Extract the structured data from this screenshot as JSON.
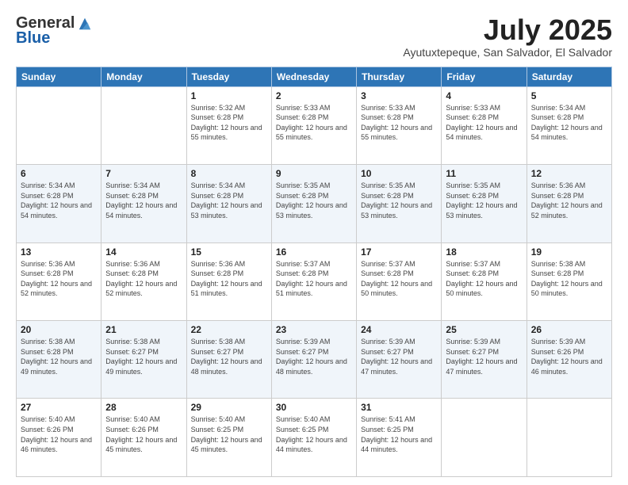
{
  "logo": {
    "general": "General",
    "blue": "Blue"
  },
  "header": {
    "month": "July 2025",
    "location": "Ayutuxtepeque, San Salvador, El Salvador"
  },
  "days_of_week": [
    "Sunday",
    "Monday",
    "Tuesday",
    "Wednesday",
    "Thursday",
    "Friday",
    "Saturday"
  ],
  "weeks": [
    [
      {
        "day": "",
        "info": ""
      },
      {
        "day": "",
        "info": ""
      },
      {
        "day": "1",
        "info": "Sunrise: 5:32 AM\nSunset: 6:28 PM\nDaylight: 12 hours and 55 minutes."
      },
      {
        "day": "2",
        "info": "Sunrise: 5:33 AM\nSunset: 6:28 PM\nDaylight: 12 hours and 55 minutes."
      },
      {
        "day": "3",
        "info": "Sunrise: 5:33 AM\nSunset: 6:28 PM\nDaylight: 12 hours and 55 minutes."
      },
      {
        "day": "4",
        "info": "Sunrise: 5:33 AM\nSunset: 6:28 PM\nDaylight: 12 hours and 54 minutes."
      },
      {
        "day": "5",
        "info": "Sunrise: 5:34 AM\nSunset: 6:28 PM\nDaylight: 12 hours and 54 minutes."
      }
    ],
    [
      {
        "day": "6",
        "info": "Sunrise: 5:34 AM\nSunset: 6:28 PM\nDaylight: 12 hours and 54 minutes."
      },
      {
        "day": "7",
        "info": "Sunrise: 5:34 AM\nSunset: 6:28 PM\nDaylight: 12 hours and 54 minutes."
      },
      {
        "day": "8",
        "info": "Sunrise: 5:34 AM\nSunset: 6:28 PM\nDaylight: 12 hours and 53 minutes."
      },
      {
        "day": "9",
        "info": "Sunrise: 5:35 AM\nSunset: 6:28 PM\nDaylight: 12 hours and 53 minutes."
      },
      {
        "day": "10",
        "info": "Sunrise: 5:35 AM\nSunset: 6:28 PM\nDaylight: 12 hours and 53 minutes."
      },
      {
        "day": "11",
        "info": "Sunrise: 5:35 AM\nSunset: 6:28 PM\nDaylight: 12 hours and 53 minutes."
      },
      {
        "day": "12",
        "info": "Sunrise: 5:36 AM\nSunset: 6:28 PM\nDaylight: 12 hours and 52 minutes."
      }
    ],
    [
      {
        "day": "13",
        "info": "Sunrise: 5:36 AM\nSunset: 6:28 PM\nDaylight: 12 hours and 52 minutes."
      },
      {
        "day": "14",
        "info": "Sunrise: 5:36 AM\nSunset: 6:28 PM\nDaylight: 12 hours and 52 minutes."
      },
      {
        "day": "15",
        "info": "Sunrise: 5:36 AM\nSunset: 6:28 PM\nDaylight: 12 hours and 51 minutes."
      },
      {
        "day": "16",
        "info": "Sunrise: 5:37 AM\nSunset: 6:28 PM\nDaylight: 12 hours and 51 minutes."
      },
      {
        "day": "17",
        "info": "Sunrise: 5:37 AM\nSunset: 6:28 PM\nDaylight: 12 hours and 50 minutes."
      },
      {
        "day": "18",
        "info": "Sunrise: 5:37 AM\nSunset: 6:28 PM\nDaylight: 12 hours and 50 minutes."
      },
      {
        "day": "19",
        "info": "Sunrise: 5:38 AM\nSunset: 6:28 PM\nDaylight: 12 hours and 50 minutes."
      }
    ],
    [
      {
        "day": "20",
        "info": "Sunrise: 5:38 AM\nSunset: 6:28 PM\nDaylight: 12 hours and 49 minutes."
      },
      {
        "day": "21",
        "info": "Sunrise: 5:38 AM\nSunset: 6:27 PM\nDaylight: 12 hours and 49 minutes."
      },
      {
        "day": "22",
        "info": "Sunrise: 5:38 AM\nSunset: 6:27 PM\nDaylight: 12 hours and 48 minutes."
      },
      {
        "day": "23",
        "info": "Sunrise: 5:39 AM\nSunset: 6:27 PM\nDaylight: 12 hours and 48 minutes."
      },
      {
        "day": "24",
        "info": "Sunrise: 5:39 AM\nSunset: 6:27 PM\nDaylight: 12 hours and 47 minutes."
      },
      {
        "day": "25",
        "info": "Sunrise: 5:39 AM\nSunset: 6:27 PM\nDaylight: 12 hours and 47 minutes."
      },
      {
        "day": "26",
        "info": "Sunrise: 5:39 AM\nSunset: 6:26 PM\nDaylight: 12 hours and 46 minutes."
      }
    ],
    [
      {
        "day": "27",
        "info": "Sunrise: 5:40 AM\nSunset: 6:26 PM\nDaylight: 12 hours and 46 minutes."
      },
      {
        "day": "28",
        "info": "Sunrise: 5:40 AM\nSunset: 6:26 PM\nDaylight: 12 hours and 45 minutes."
      },
      {
        "day": "29",
        "info": "Sunrise: 5:40 AM\nSunset: 6:25 PM\nDaylight: 12 hours and 45 minutes."
      },
      {
        "day": "30",
        "info": "Sunrise: 5:40 AM\nSunset: 6:25 PM\nDaylight: 12 hours and 44 minutes."
      },
      {
        "day": "31",
        "info": "Sunrise: 5:41 AM\nSunset: 6:25 PM\nDaylight: 12 hours and 44 minutes."
      },
      {
        "day": "",
        "info": ""
      },
      {
        "day": "",
        "info": ""
      }
    ]
  ]
}
